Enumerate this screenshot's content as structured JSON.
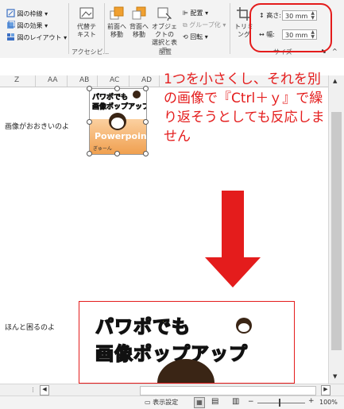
{
  "ribbon": {
    "picture_border": "図の枠線",
    "picture_effects": "図の効果",
    "picture_layout": "図のレイアウト",
    "alt_text": [
      "代替テ",
      "キスト"
    ],
    "accessibility": "アクセシビ...",
    "bring_forward": [
      "前面へ",
      "移動"
    ],
    "send_backward": [
      "背面へ",
      "移動"
    ],
    "selection_pane": [
      "オブジェクトの",
      "選択と表示"
    ],
    "align": "配置",
    "group": "グループ化",
    "rotate": "回転",
    "arrange_group": "配置",
    "crop": "トリミング",
    "height_label": "高さ:",
    "height_value": "30 mm",
    "width_label": "幅:",
    "width_value": "30 mm",
    "size_group": "サイズ"
  },
  "columns": [
    "Z",
    "AA",
    "AB",
    "AC",
    "AD"
  ],
  "cells": {
    "row1": "画像がおおきいのよ",
    "row2": "ほんと困るのよ"
  },
  "annotation": "1つを小さくし、それを別の画像で『Ctrl＋ｙ』で繰り返そうとしても反応しません",
  "small_image": {
    "title_line1": "パワポでも",
    "title_line2": "画像ポップアップ",
    "brand": "Powerpoint",
    "tag": "ぎゅーん"
  },
  "big_image": {
    "title_line1": "パワポでも",
    "title_line2": "画像ポップアップ"
  },
  "status": {
    "display_settings": "表示設定",
    "zoom": "100%"
  },
  "colors": {
    "accent_red": "#e41c1c",
    "title_yellow": "#f4e81c"
  }
}
